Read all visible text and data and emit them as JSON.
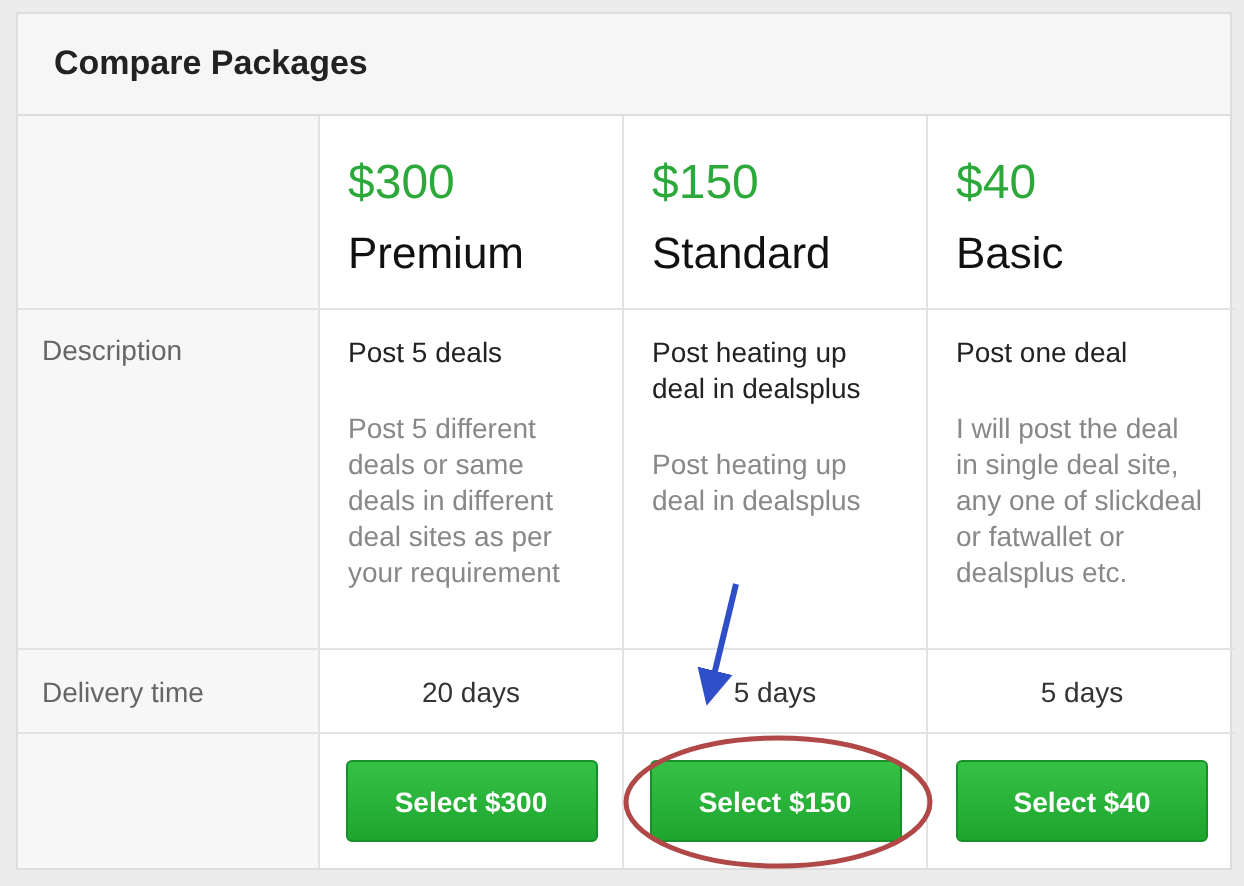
{
  "panel": {
    "title": "Compare Packages"
  },
  "row_labels": [
    "Description",
    "Delivery time"
  ],
  "packages": [
    {
      "price": "$300",
      "name": "Premium",
      "summary": "Post 5 deals",
      "details": "Post 5 different deals or same deals in different deal sites as per your requirement",
      "delivery": "20 days",
      "button": "Select $300"
    },
    {
      "price": "$150",
      "name": "Standard",
      "summary": "Post heating up deal in dealsplus",
      "details": "Post heating up deal in dealsplus",
      "delivery": "5 days",
      "button": "Select $150"
    },
    {
      "price": "$40",
      "name": "Basic",
      "summary": "Post one deal",
      "details": "I will post the deal in single deal site, any one of slickdeal or fatwallet or dealsplus etc.",
      "delivery": "5 days",
      "button": "Select $40"
    }
  ]
}
